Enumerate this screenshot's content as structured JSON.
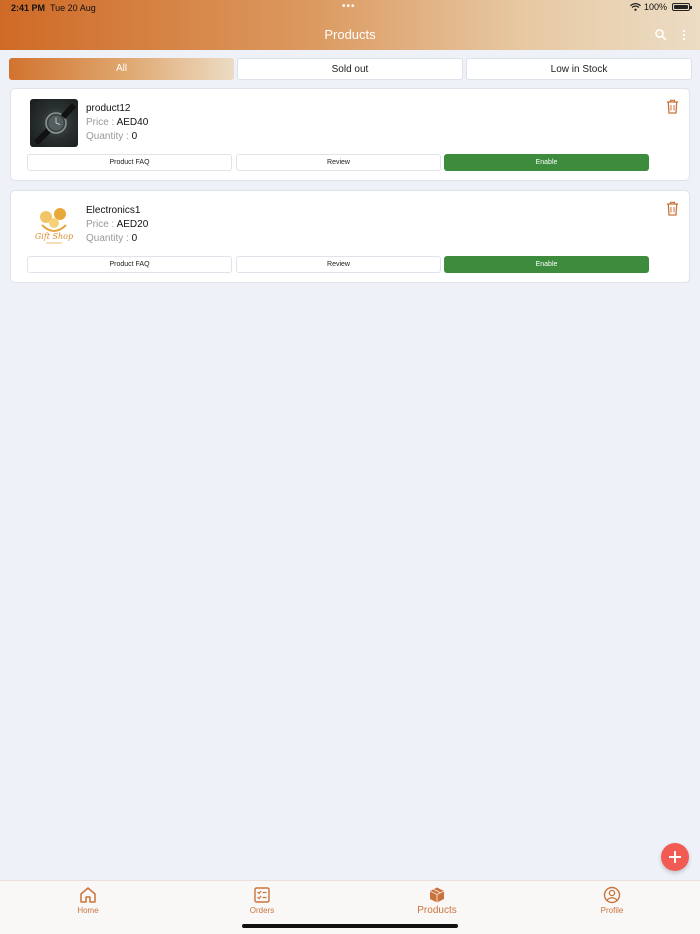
{
  "status_bar": {
    "time": "2:41 PM",
    "date": "Tue 20 Aug",
    "dots": "•••",
    "battery": "100%"
  },
  "header": {
    "title": "Products",
    "search_icon": "search-icon",
    "more_icon": "more-vertical-icon"
  },
  "tabs": [
    {
      "label": "All",
      "active": true
    },
    {
      "label": "Sold out",
      "active": false
    },
    {
      "label": "Low in Stock",
      "active": false
    }
  ],
  "products": [
    {
      "name": "product12",
      "price_label": "Price :",
      "price": "AED40",
      "quantity_label": "Quantity :",
      "quantity": "0",
      "buttons": {
        "faq": "Product FAQ",
        "review": "Review",
        "enable": "Enable"
      }
    },
    {
      "name": "Electronics1",
      "price_label": "Price :",
      "price": "AED20",
      "quantity_label": "Quantity :",
      "quantity": "0",
      "logo_text": "Gift Shop",
      "buttons": {
        "faq": "Product FAQ",
        "review": "Review",
        "enable": "Enable"
      }
    }
  ],
  "bottom_nav": [
    {
      "label": "Home",
      "icon": "home-icon"
    },
    {
      "label": "Orders",
      "icon": "orders-icon"
    },
    {
      "label": "Products",
      "icon": "box-icon",
      "active": true
    },
    {
      "label": "Profile",
      "icon": "profile-icon"
    }
  ],
  "colors": {
    "accent": "#cf6a26",
    "enable_green": "#3d8b3d",
    "fab_red": "#f25b54",
    "background": "#eef1f7"
  }
}
